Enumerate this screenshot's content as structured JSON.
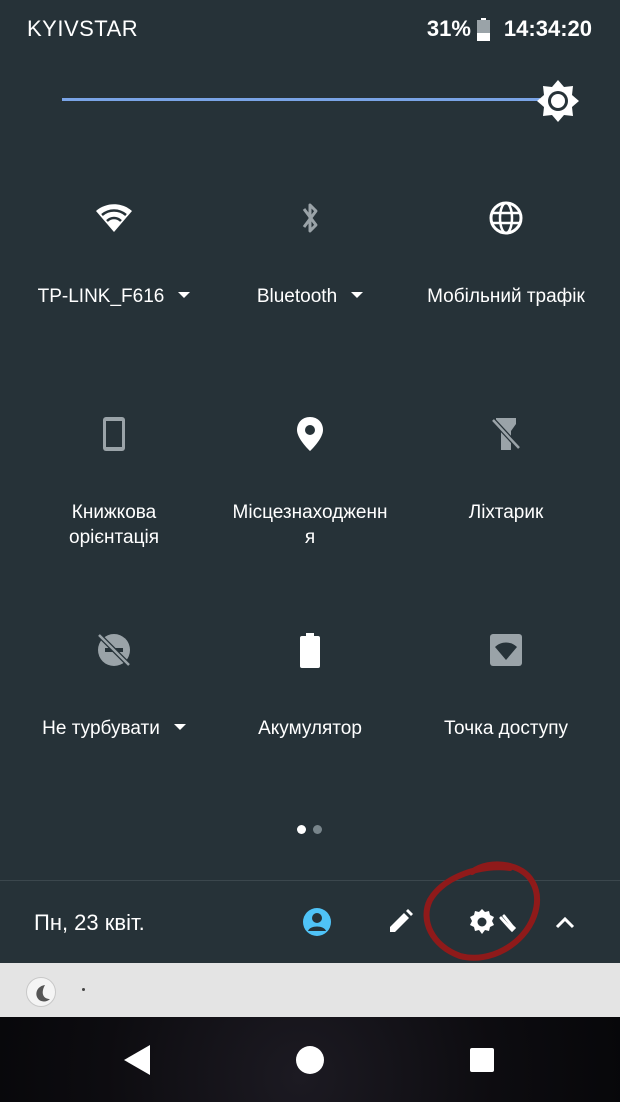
{
  "status_bar": {
    "carrier": "KYIVSTAR",
    "battery_percent": "31%",
    "time": "14:34:20"
  },
  "brightness": {
    "level": 1.0
  },
  "tiles": [
    {
      "label": "TP-LINK_F616",
      "icon": "wifi-icon",
      "dropdown": true
    },
    {
      "label": "Bluetooth",
      "icon": "bluetooth-off-icon",
      "dropdown": true
    },
    {
      "label": "Мобільний трафік",
      "icon": "globe-icon",
      "dropdown": false
    },
    {
      "label_line1": "Книжкова",
      "label_line2": "орієнтація",
      "icon": "portrait-phone-icon"
    },
    {
      "label_line1": "Місцезнаходженн",
      "label_line2": "я",
      "icon": "location-pin-icon"
    },
    {
      "label": "Ліхтарик",
      "icon": "flashlight-off-icon",
      "dropdown": false
    },
    {
      "label": "Не турбувати",
      "icon": "do-not-disturb-off-icon",
      "dropdown": true
    },
    {
      "label": "Акумулятор",
      "icon": "battery-icon",
      "dropdown": false
    },
    {
      "label": "Точка доступу",
      "icon": "hotspot-icon",
      "dropdown": false
    }
  ],
  "page_dots": {
    "count": 2,
    "active": 0
  },
  "footer": {
    "date": "Пн, 23 квіт.",
    "icons": [
      "user-account-icon",
      "edit-pencil-icon",
      "settings-gear-icon",
      "collapse-chevron-icon"
    ]
  },
  "notification": {
    "icon": "moon-icon"
  },
  "nav": {
    "buttons": [
      "back-icon",
      "home-icon",
      "recents-icon"
    ]
  },
  "colors": {
    "panel_bg": "#263238",
    "accent": "#4fc3f7",
    "slider": "#7aa4e6",
    "annotation": "#9b1c1c"
  }
}
